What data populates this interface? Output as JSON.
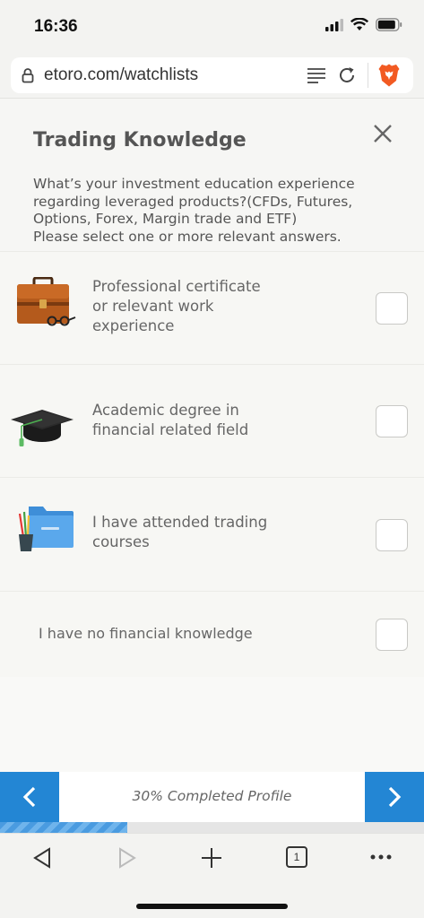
{
  "status": {
    "time": "16:36"
  },
  "browser": {
    "url": "etoro.com/watchlists"
  },
  "dialog": {
    "title": "Trading Knowledge",
    "question_lines": [
      "What’s your investment education experience",
      "regarding leveraged products?(CFDs, Futures,",
      "Options, Forex, Margin trade and ETF)",
      "Please select one or more relevant answers."
    ],
    "options": [
      {
        "lines": [
          "Professional certificate",
          "or relevant work",
          "experience"
        ],
        "icon": "briefcase-icon",
        "checked": false
      },
      {
        "lines": [
          "Academic degree in",
          "financial related field"
        ],
        "icon": "graduation-cap-icon",
        "checked": false
      },
      {
        "lines": [
          "I have attended trading",
          "courses"
        ],
        "icon": "folder-icon",
        "checked": false
      },
      {
        "lines": [
          "I have no financial knowledge"
        ],
        "icon": "",
        "checked": false
      }
    ]
  },
  "progress": {
    "label": "30% Completed Profile",
    "fraction": 0.3
  },
  "toolbar": {
    "tab_count": "1"
  },
  "colors": {
    "accent": "#2386d4"
  }
}
